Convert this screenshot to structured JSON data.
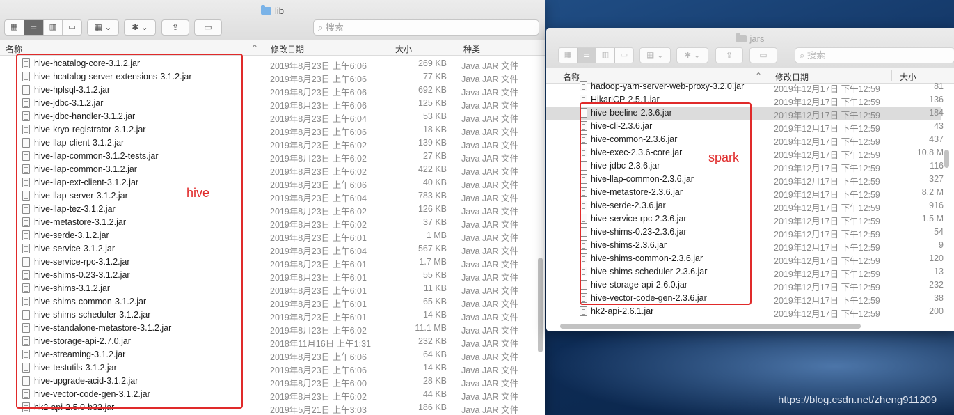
{
  "lib_window": {
    "title": "lib",
    "search_placeholder": "搜索",
    "columns": {
      "name": "名称",
      "date": "修改日期",
      "size": "大小",
      "kind": "种类"
    },
    "files": [
      {
        "name": "hive-hcatalog-core-3.1.2.jar",
        "date": "2019年8月23日 上午6:06",
        "size": "269 KB",
        "kind": "Java JAR 文件"
      },
      {
        "name": "hive-hcatalog-server-extensions-3.1.2.jar",
        "date": "2019年8月23日 上午6:06",
        "size": "77 KB",
        "kind": "Java JAR 文件"
      },
      {
        "name": "hive-hplsql-3.1.2.jar",
        "date": "2019年8月23日 上午6:06",
        "size": "692 KB",
        "kind": "Java JAR 文件"
      },
      {
        "name": "hive-jdbc-3.1.2.jar",
        "date": "2019年8月23日 上午6:06",
        "size": "125 KB",
        "kind": "Java JAR 文件"
      },
      {
        "name": "hive-jdbc-handler-3.1.2.jar",
        "date": "2019年8月23日 上午6:04",
        "size": "53 KB",
        "kind": "Java JAR 文件"
      },
      {
        "name": "hive-kryo-registrator-3.1.2.jar",
        "date": "2019年8月23日 上午6:06",
        "size": "18 KB",
        "kind": "Java JAR 文件"
      },
      {
        "name": "hive-llap-client-3.1.2.jar",
        "date": "2019年8月23日 上午6:02",
        "size": "139 KB",
        "kind": "Java JAR 文件"
      },
      {
        "name": "hive-llap-common-3.1.2-tests.jar",
        "date": "2019年8月23日 上午6:02",
        "size": "27 KB",
        "kind": "Java JAR 文件"
      },
      {
        "name": "hive-llap-common-3.1.2.jar",
        "date": "2019年8月23日 上午6:02",
        "size": "422 KB",
        "kind": "Java JAR 文件"
      },
      {
        "name": "hive-llap-ext-client-3.1.2.jar",
        "date": "2019年8月23日 上午6:06",
        "size": "40 KB",
        "kind": "Java JAR 文件"
      },
      {
        "name": "hive-llap-server-3.1.2.jar",
        "date": "2019年8月23日 上午6:04",
        "size": "783 KB",
        "kind": "Java JAR 文件"
      },
      {
        "name": "hive-llap-tez-3.1.2.jar",
        "date": "2019年8月23日 上午6:02",
        "size": "126 KB",
        "kind": "Java JAR 文件"
      },
      {
        "name": "hive-metastore-3.1.2.jar",
        "date": "2019年8月23日 上午6:02",
        "size": "37 KB",
        "kind": "Java JAR 文件"
      },
      {
        "name": "hive-serde-3.1.2.jar",
        "date": "2019年8月23日 上午6:01",
        "size": "1 MB",
        "kind": "Java JAR 文件"
      },
      {
        "name": "hive-service-3.1.2.jar",
        "date": "2019年8月23日 上午6:04",
        "size": "567 KB",
        "kind": "Java JAR 文件"
      },
      {
        "name": "hive-service-rpc-3.1.2.jar",
        "date": "2019年8月23日 上午6:01",
        "size": "1.7 MB",
        "kind": "Java JAR 文件"
      },
      {
        "name": "hive-shims-0.23-3.1.2.jar",
        "date": "2019年8月23日 上午6:01",
        "size": "55 KB",
        "kind": "Java JAR 文件"
      },
      {
        "name": "hive-shims-3.1.2.jar",
        "date": "2019年8月23日 上午6:01",
        "size": "11 KB",
        "kind": "Java JAR 文件"
      },
      {
        "name": "hive-shims-common-3.1.2.jar",
        "date": "2019年8月23日 上午6:01",
        "size": "65 KB",
        "kind": "Java JAR 文件"
      },
      {
        "name": "hive-shims-scheduler-3.1.2.jar",
        "date": "2019年8月23日 上午6:01",
        "size": "14 KB",
        "kind": "Java JAR 文件"
      },
      {
        "name": "hive-standalone-metastore-3.1.2.jar",
        "date": "2019年8月23日 上午6:02",
        "size": "11.1 MB",
        "kind": "Java JAR 文件"
      },
      {
        "name": "hive-storage-api-2.7.0.jar",
        "date": "2018年11月16日 上午1:31",
        "size": "232 KB",
        "kind": "Java JAR 文件"
      },
      {
        "name": "hive-streaming-3.1.2.jar",
        "date": "2019年8月23日 上午6:06",
        "size": "64 KB",
        "kind": "Java JAR 文件"
      },
      {
        "name": "hive-testutils-3.1.2.jar",
        "date": "2019年8月23日 上午6:06",
        "size": "14 KB",
        "kind": "Java JAR 文件"
      },
      {
        "name": "hive-upgrade-acid-3.1.2.jar",
        "date": "2019年8月23日 上午6:00",
        "size": "28 KB",
        "kind": "Java JAR 文件"
      },
      {
        "name": "hive-vector-code-gen-3.1.2.jar",
        "date": "2019年8月23日 上午6:02",
        "size": "44 KB",
        "kind": "Java JAR 文件"
      },
      {
        "name": "hk2-api-2.5.0-b32.jar",
        "date": "2019年5月21日 上午3:03",
        "size": "186 KB",
        "kind": "Java JAR 文件"
      }
    ],
    "annotation": "hive"
  },
  "jars_window": {
    "title": "jars",
    "search_placeholder": "搜索",
    "columns": {
      "name": "名称",
      "date": "修改日期",
      "size": "大小"
    },
    "files": [
      {
        "name": "hadoop-yarn-server-web-proxy-3.2.0.jar",
        "date": "2019年12月17日 下午12:59",
        "size": "81"
      },
      {
        "name": "HikariCP-2.5.1.jar",
        "date": "2019年12月17日 下午12:59",
        "size": "136"
      },
      {
        "name": "hive-beeline-2.3.6.jar",
        "date": "2019年12月17日 下午12:59",
        "size": "184"
      },
      {
        "name": "hive-cli-2.3.6.jar",
        "date": "2019年12月17日 下午12:59",
        "size": "43"
      },
      {
        "name": "hive-common-2.3.6.jar",
        "date": "2019年12月17日 下午12:59",
        "size": "437"
      },
      {
        "name": "hive-exec-2.3.6-core.jar",
        "date": "2019年12月17日 下午12:59",
        "size": "10.8 M"
      },
      {
        "name": "hive-jdbc-2.3.6.jar",
        "date": "2019年12月17日 下午12:59",
        "size": "116"
      },
      {
        "name": "hive-llap-common-2.3.6.jar",
        "date": "2019年12月17日 下午12:59",
        "size": "327"
      },
      {
        "name": "hive-metastore-2.3.6.jar",
        "date": "2019年12月17日 下午12:59",
        "size": "8.2 M"
      },
      {
        "name": "hive-serde-2.3.6.jar",
        "date": "2019年12月17日 下午12:59",
        "size": "916"
      },
      {
        "name": "hive-service-rpc-2.3.6.jar",
        "date": "2019年12月17日 下午12:59",
        "size": "1.5 M"
      },
      {
        "name": "hive-shims-0.23-2.3.6.jar",
        "date": "2019年12月17日 下午12:59",
        "size": "54"
      },
      {
        "name": "hive-shims-2.3.6.jar",
        "date": "2019年12月17日 下午12:59",
        "size": "9"
      },
      {
        "name": "hive-shims-common-2.3.6.jar",
        "date": "2019年12月17日 下午12:59",
        "size": "120"
      },
      {
        "name": "hive-shims-scheduler-2.3.6.jar",
        "date": "2019年12月17日 下午12:59",
        "size": "13"
      },
      {
        "name": "hive-storage-api-2.6.0.jar",
        "date": "2019年12月17日 下午12:59",
        "size": "232"
      },
      {
        "name": "hive-vector-code-gen-2.3.6.jar",
        "date": "2019年12月17日 下午12:59",
        "size": "38"
      },
      {
        "name": "hk2-api-2.6.1.jar",
        "date": "2019年12月17日 下午12:59",
        "size": "200"
      }
    ],
    "selected_index": 2,
    "annotation": "spark"
  },
  "watermark": "https://blog.csdn.net/zheng911209",
  "colors": {
    "annotation_red": "#e02a2a",
    "selection": "#dcdcdc"
  }
}
